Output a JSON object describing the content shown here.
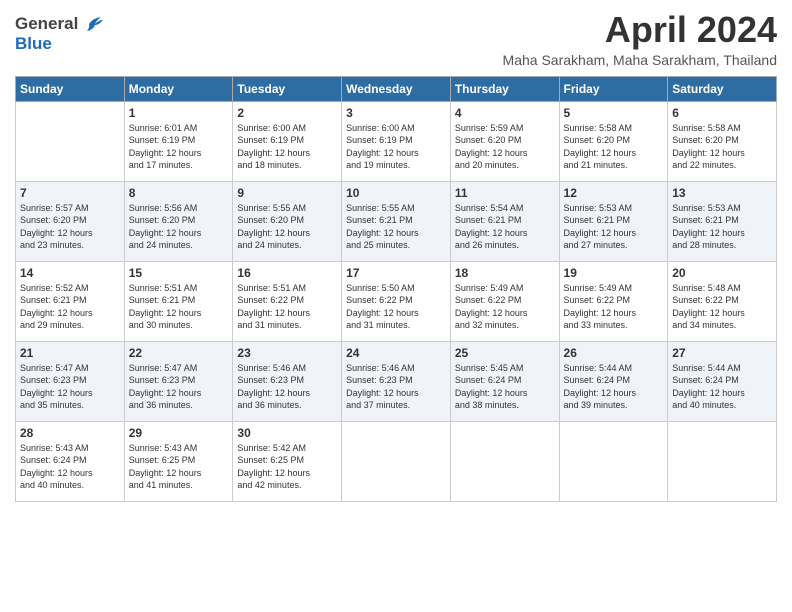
{
  "header": {
    "logo_general": "General",
    "logo_blue": "Blue",
    "month_title": "April 2024",
    "subtitle": "Maha Sarakham, Maha Sarakham, Thailand"
  },
  "columns": [
    "Sunday",
    "Monday",
    "Tuesday",
    "Wednesday",
    "Thursday",
    "Friday",
    "Saturday"
  ],
  "weeks": [
    [
      {
        "day": "",
        "info": ""
      },
      {
        "day": "1",
        "info": "Sunrise: 6:01 AM\nSunset: 6:19 PM\nDaylight: 12 hours\nand 17 minutes."
      },
      {
        "day": "2",
        "info": "Sunrise: 6:00 AM\nSunset: 6:19 PM\nDaylight: 12 hours\nand 18 minutes."
      },
      {
        "day": "3",
        "info": "Sunrise: 6:00 AM\nSunset: 6:19 PM\nDaylight: 12 hours\nand 19 minutes."
      },
      {
        "day": "4",
        "info": "Sunrise: 5:59 AM\nSunset: 6:20 PM\nDaylight: 12 hours\nand 20 minutes."
      },
      {
        "day": "5",
        "info": "Sunrise: 5:58 AM\nSunset: 6:20 PM\nDaylight: 12 hours\nand 21 minutes."
      },
      {
        "day": "6",
        "info": "Sunrise: 5:58 AM\nSunset: 6:20 PM\nDaylight: 12 hours\nand 22 minutes."
      }
    ],
    [
      {
        "day": "7",
        "info": "Sunrise: 5:57 AM\nSunset: 6:20 PM\nDaylight: 12 hours\nand 23 minutes."
      },
      {
        "day": "8",
        "info": "Sunrise: 5:56 AM\nSunset: 6:20 PM\nDaylight: 12 hours\nand 24 minutes."
      },
      {
        "day": "9",
        "info": "Sunrise: 5:55 AM\nSunset: 6:20 PM\nDaylight: 12 hours\nand 24 minutes."
      },
      {
        "day": "10",
        "info": "Sunrise: 5:55 AM\nSunset: 6:21 PM\nDaylight: 12 hours\nand 25 minutes."
      },
      {
        "day": "11",
        "info": "Sunrise: 5:54 AM\nSunset: 6:21 PM\nDaylight: 12 hours\nand 26 minutes."
      },
      {
        "day": "12",
        "info": "Sunrise: 5:53 AM\nSunset: 6:21 PM\nDaylight: 12 hours\nand 27 minutes."
      },
      {
        "day": "13",
        "info": "Sunrise: 5:53 AM\nSunset: 6:21 PM\nDaylight: 12 hours\nand 28 minutes."
      }
    ],
    [
      {
        "day": "14",
        "info": "Sunrise: 5:52 AM\nSunset: 6:21 PM\nDaylight: 12 hours\nand 29 minutes."
      },
      {
        "day": "15",
        "info": "Sunrise: 5:51 AM\nSunset: 6:21 PM\nDaylight: 12 hours\nand 30 minutes."
      },
      {
        "day": "16",
        "info": "Sunrise: 5:51 AM\nSunset: 6:22 PM\nDaylight: 12 hours\nand 31 minutes."
      },
      {
        "day": "17",
        "info": "Sunrise: 5:50 AM\nSunset: 6:22 PM\nDaylight: 12 hours\nand 31 minutes."
      },
      {
        "day": "18",
        "info": "Sunrise: 5:49 AM\nSunset: 6:22 PM\nDaylight: 12 hours\nand 32 minutes."
      },
      {
        "day": "19",
        "info": "Sunrise: 5:49 AM\nSunset: 6:22 PM\nDaylight: 12 hours\nand 33 minutes."
      },
      {
        "day": "20",
        "info": "Sunrise: 5:48 AM\nSunset: 6:22 PM\nDaylight: 12 hours\nand 34 minutes."
      }
    ],
    [
      {
        "day": "21",
        "info": "Sunrise: 5:47 AM\nSunset: 6:23 PM\nDaylight: 12 hours\nand 35 minutes."
      },
      {
        "day": "22",
        "info": "Sunrise: 5:47 AM\nSunset: 6:23 PM\nDaylight: 12 hours\nand 36 minutes."
      },
      {
        "day": "23",
        "info": "Sunrise: 5:46 AM\nSunset: 6:23 PM\nDaylight: 12 hours\nand 36 minutes."
      },
      {
        "day": "24",
        "info": "Sunrise: 5:46 AM\nSunset: 6:23 PM\nDaylight: 12 hours\nand 37 minutes."
      },
      {
        "day": "25",
        "info": "Sunrise: 5:45 AM\nSunset: 6:24 PM\nDaylight: 12 hours\nand 38 minutes."
      },
      {
        "day": "26",
        "info": "Sunrise: 5:44 AM\nSunset: 6:24 PM\nDaylight: 12 hours\nand 39 minutes."
      },
      {
        "day": "27",
        "info": "Sunrise: 5:44 AM\nSunset: 6:24 PM\nDaylight: 12 hours\nand 40 minutes."
      }
    ],
    [
      {
        "day": "28",
        "info": "Sunrise: 5:43 AM\nSunset: 6:24 PM\nDaylight: 12 hours\nand 40 minutes."
      },
      {
        "day": "29",
        "info": "Sunrise: 5:43 AM\nSunset: 6:25 PM\nDaylight: 12 hours\nand 41 minutes."
      },
      {
        "day": "30",
        "info": "Sunrise: 5:42 AM\nSunset: 6:25 PM\nDaylight: 12 hours\nand 42 minutes."
      },
      {
        "day": "",
        "info": ""
      },
      {
        "day": "",
        "info": ""
      },
      {
        "day": "",
        "info": ""
      },
      {
        "day": "",
        "info": ""
      }
    ]
  ]
}
